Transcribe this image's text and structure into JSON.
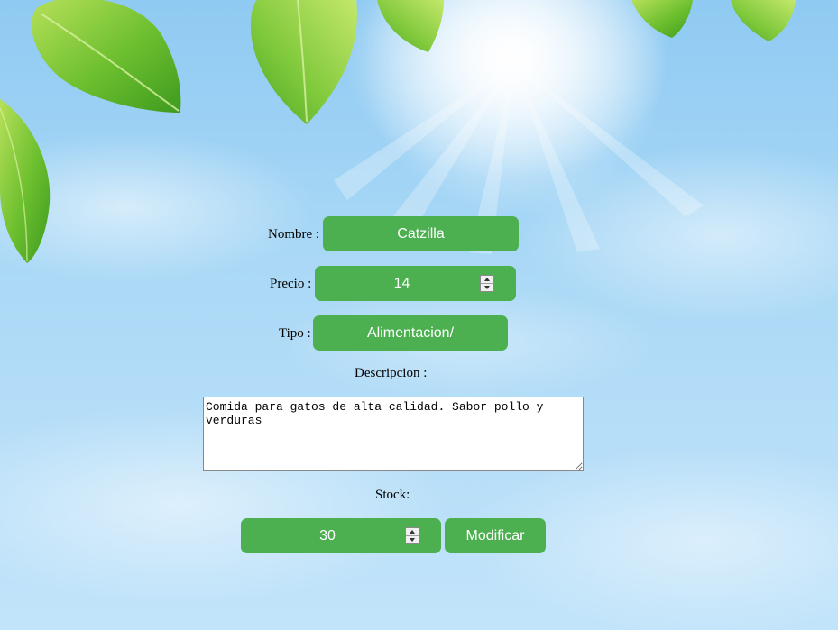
{
  "form": {
    "nombre_label": "Nombre :",
    "nombre_value": "Catzilla",
    "precio_label": "Precio :",
    "precio_value": "14",
    "tipo_label": "Tipo :",
    "tipo_value": "Alimentacion/",
    "descripcion_label": "Descripcion :",
    "descripcion_value": "Comida para gatos de alta calidad. Sabor pollo y verduras",
    "stock_label": "Stock:",
    "stock_value": "30",
    "submit_label": "Modificar"
  },
  "colors": {
    "accent": "#4caf50",
    "accent_text": "#ffffff",
    "sky": "#a9d8f6",
    "leaf": "#7cc63a"
  }
}
